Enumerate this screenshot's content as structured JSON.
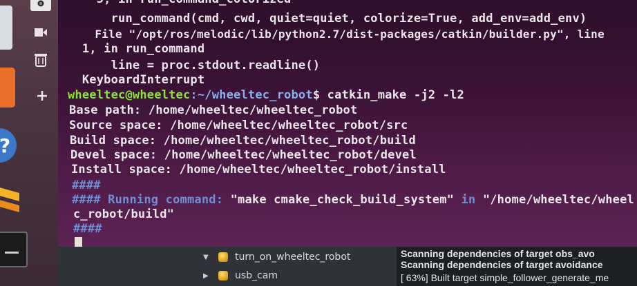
{
  "terminal": {
    "lines": [
      "    5, in run_command_colorized",
      "      run_command(cmd, cwd, quiet=quiet, colorize=True, add_env=add_env)",
      "    File \"/opt/ros/melodic/lib/python2.7/dist-packages/catkin/builder.py\", line",
      "  1, in run_command",
      "      line = proc.stdout.readline()",
      "  KeyboardInterrupt"
    ],
    "prompt_user": "wheeltec@wheeltec",
    "prompt_path": ":~/wheeltec_robot",
    "prompt_cmd": "$ catkin_make -j2 -l2",
    "spaces": [
      "Base path: /home/wheeltec/wheeltec_robot",
      "Source space: /home/wheeltec/wheeltec_robot/src",
      "Build space: /home/wheeltec/wheeltec_robot/build",
      "Devel space: /home/wheeltec/wheeltec_robot/devel",
      "Install space: /home/wheeltec/wheeltec_robot/install"
    ],
    "hash_line": "####",
    "running_prefix": "#### Running command: ",
    "running_cmd": "\"make cmake_check_build_system\"",
    "running_in": " in ",
    "running_dir": "\"/home/wheeltec/wheel",
    "running_dir_cont": "c_robot/build\"",
    "hash_line_end": "####"
  },
  "file_tree": {
    "items": [
      {
        "label": "turn_on_wheeltec_robot",
        "expanded": true
      },
      {
        "label": "usb_cam",
        "expanded": false
      }
    ]
  },
  "messages": {
    "lines": [
      "Scanning dependencies of target obs_avo",
      "Scanning dependencies of target avoidance",
      "[ 63%] Built target simple_follower_generate_me"
    ]
  },
  "icons": {
    "launcher": [
      "camera-icon",
      "media-icon",
      "trash-icon",
      "add-icon",
      "help-icon",
      "app-icon",
      "terminal-icon"
    ]
  },
  "colors": {
    "prompt_user": "#8ae234",
    "prompt_path": "#8aaee8",
    "terminal_bg": "#3a1235"
  }
}
